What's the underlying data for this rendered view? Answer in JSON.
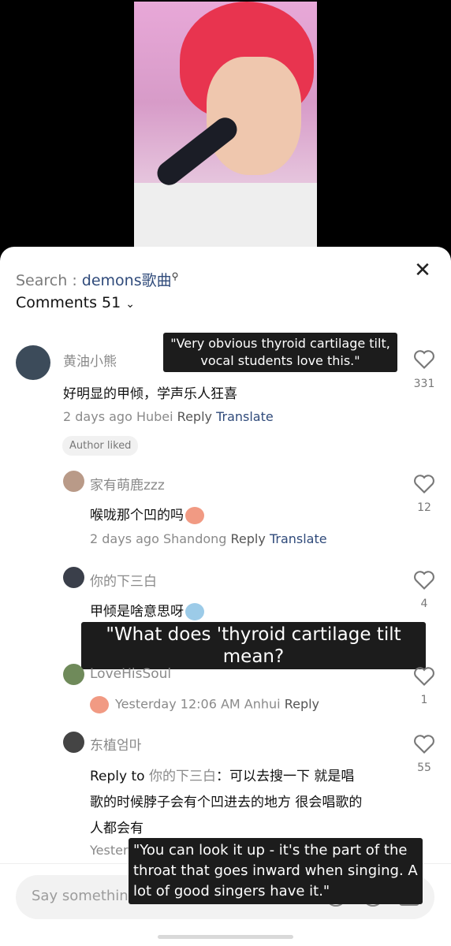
{
  "search": {
    "prefix": "Search : ",
    "query": "demons歌曲"
  },
  "comments_header": {
    "label": "Comments 51"
  },
  "comments": [
    {
      "user": "黄油小熊",
      "text": "好明显的甲倾，学声乐人狂喜",
      "time": "2 days ago Hubei",
      "reply": "Reply",
      "translate": "Translate",
      "likes": "331",
      "badge": "Author liked",
      "caption": "\"Very obvious thyroid cartilage tilt,\nvocal students love this.\""
    },
    {
      "user": "家有萌鹿zzz",
      "text": "喉咙那个凹的吗",
      "time": "2 days ago Shandong",
      "reply": "Reply",
      "translate": "Translate",
      "likes": "12"
    },
    {
      "user": "你的下三白",
      "text": "甲倾是啥意思呀",
      "likes": "4",
      "caption": "\"What does 'thyroid cartilage tilt mean?"
    },
    {
      "user": "LoveHisSoul",
      "time": "Yesterday 12:06 AM Anhui",
      "reply": "Reply",
      "likes": "1"
    },
    {
      "user": "东植엄마",
      "reply_to": "Reply to",
      "reply_to_user": "你的下三白",
      "text1": "：可以去搜一下 就是唱",
      "text2": "歌的时候脖子会有个凹进去的地方 很会唱歌的",
      "text3": "人都会有",
      "time_partial": "Yester",
      "likes": "55",
      "caption": "\"You can look it up - it's the part of the\nthroat that goes inward when singing. A\nlot of good singers have it.\""
    }
  ],
  "input": {
    "placeholder": "Say something"
  },
  "colors": {
    "accent_blue": "#2f4a7a",
    "hair_red": "#e8344f"
  }
}
